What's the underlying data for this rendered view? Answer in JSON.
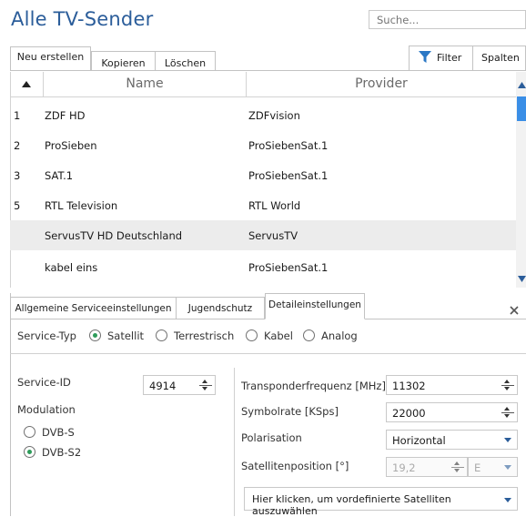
{
  "window": {
    "title": "Alle TV-Sender"
  },
  "search": {
    "placeholder": "Suche..."
  },
  "toolbar": {
    "new_label": "Neu erstellen",
    "copy_label": "Kopieren",
    "delete_label": "Löschen",
    "filter_label": "Filter",
    "columns_label": "Spalten"
  },
  "table": {
    "columns": [
      "Name",
      "Provider"
    ],
    "rows": [
      {
        "num": "1",
        "name": "ZDF HD",
        "provider": "ZDFvision"
      },
      {
        "num": "2",
        "name": "ProSieben",
        "provider": "ProSiebenSat.1"
      },
      {
        "num": "3",
        "name": "SAT.1",
        "provider": "ProSiebenSat.1"
      },
      {
        "num": "5",
        "name": "RTL Television",
        "provider": "RTL World"
      },
      {
        "num": "",
        "name": "ServusTV HD Deutschland",
        "provider": "ServusTV"
      },
      {
        "num": "",
        "name": "kabel eins",
        "provider": "ProSiebenSat.1"
      }
    ],
    "selected_row": 4
  },
  "detail_tabs": [
    "Allgemeine Serviceeinstellungen",
    "Jugendschutz",
    "Detaileinstellungen"
  ],
  "service_type": {
    "label": "Service-Typ",
    "options": [
      "Satellit",
      "Terrestrisch",
      "Kabel",
      "Analog"
    ],
    "selected": "Satellit"
  },
  "details": {
    "service_id_label": "Service-ID",
    "service_id_value": "4914",
    "modulation_label": "Modulation",
    "modulation_options": [
      "DVB-S",
      "DVB-S2"
    ],
    "modulation_selected": "DVB-S2",
    "transponder_label": "Transponderfrequenz [MHz]",
    "transponder_value": "11302",
    "symbolrate_label": "Symbolrate [KSps]",
    "symbolrate_value": "22000",
    "polarisation_label": "Polarisation",
    "polarisation_value": "Horizontal",
    "satpos_label": "Satellitenposition [°]",
    "satpos_value": "19,2",
    "satpos_dir": "E",
    "predefined_label": "Hier klicken, um vordefinierte Satelliten auszuwählen"
  },
  "colors": {
    "accent": "#2b5d9a",
    "radio_on": "#2e9c5a",
    "scroll_thumb": "#3a8ee6"
  }
}
